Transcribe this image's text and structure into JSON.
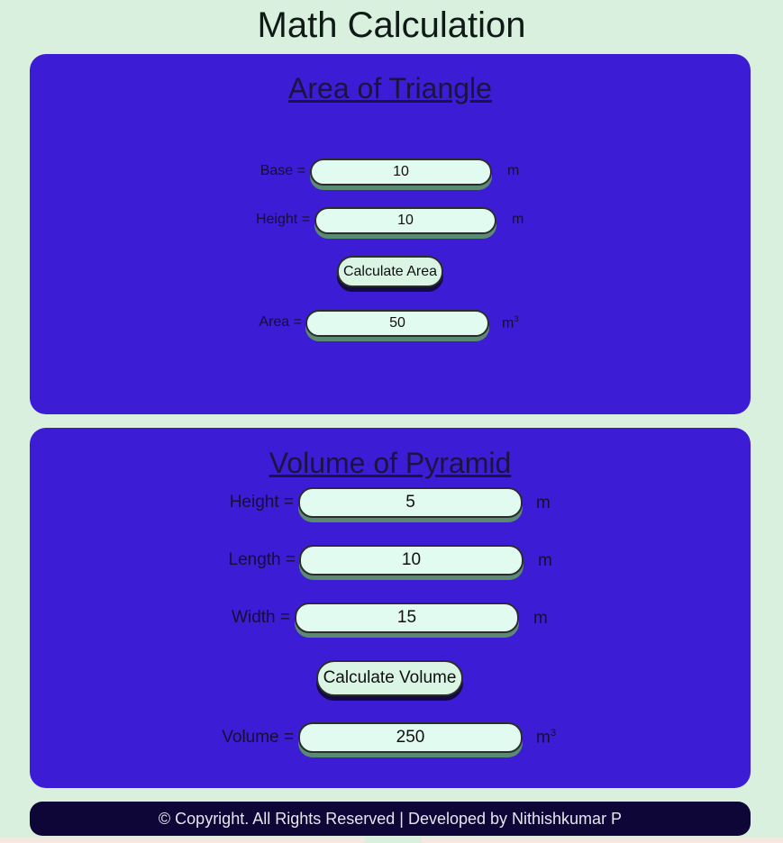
{
  "page": {
    "title": "Math Calculation"
  },
  "triangle": {
    "title": "Area of Triangle",
    "base_label": "Base =",
    "base_value": "10",
    "base_unit": "m",
    "height_label": "Height =",
    "height_value": "10",
    "height_unit": "m",
    "button_label": "Calculate Area",
    "area_label": "Area =",
    "area_value": "50",
    "area_unit": "m",
    "area_unit_exp": "3"
  },
  "pyramid": {
    "title": "Volume of Pyramid",
    "height_label": "Height =",
    "height_value": "5",
    "height_unit": "m",
    "length_label": "Length =",
    "length_value": "10",
    "length_unit": "m",
    "width_label": "Width =",
    "width_value": "15",
    "width_unit": "m",
    "button_label": "Calculate Volume",
    "volume_label": "Volume =",
    "volume_value": "250",
    "volume_unit": "m",
    "volume_unit_exp": "3"
  },
  "footer": {
    "text": "© Copyright. All Rights Reserved | Developed by Nithishkumar P"
  },
  "colors": {
    "page_bg": "#d8f0dd",
    "card_bg": "#3c1cd4",
    "field_bg": "#e2fbf0",
    "footer_bg": "#0e0636"
  }
}
